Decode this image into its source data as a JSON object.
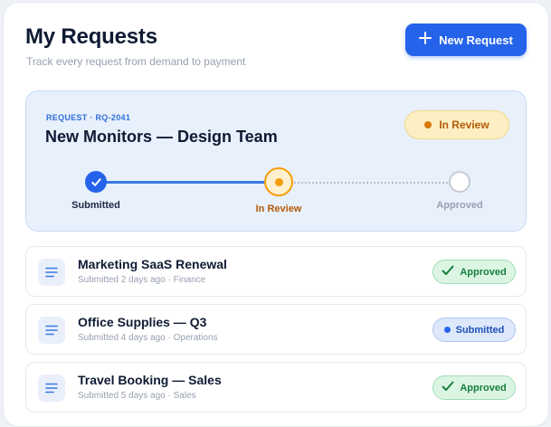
{
  "header": {
    "title": "My Requests",
    "subtitle": "Track every request from demand to payment",
    "new_button_label": "New Request",
    "new_button_icon": "plus-icon"
  },
  "featured": {
    "id_label": "REQUEST · RQ-2041",
    "title": "New Monitors — Design Team",
    "status": "In Review",
    "status_color": "#d97706",
    "steps": [
      {
        "label": "Submitted",
        "state": "complete",
        "color": "#2563eb"
      },
      {
        "label": "In Review",
        "state": "current",
        "color": "#f59e0b"
      },
      {
        "label": "Approved",
        "state": "pending",
        "color": "#c5ccd6"
      }
    ]
  },
  "requests": [
    {
      "title": "Marketing SaaS Renewal",
      "meta": "Submitted 2 days ago · Finance",
      "status": "Approved",
      "icon": "document-icon"
    },
    {
      "title": "Office Supplies — Q3",
      "meta": "Submitted 4 days ago · Operations",
      "status": "Submitted",
      "icon": "document-icon"
    },
    {
      "title": "Travel Booking — Sales",
      "meta": "Submitted 5 days ago · Sales",
      "status": "Approved",
      "icon": "document-icon"
    }
  ],
  "colors": {
    "accent": "#2563eb",
    "approved": "#15803d",
    "in_review": "#b45a07"
  }
}
